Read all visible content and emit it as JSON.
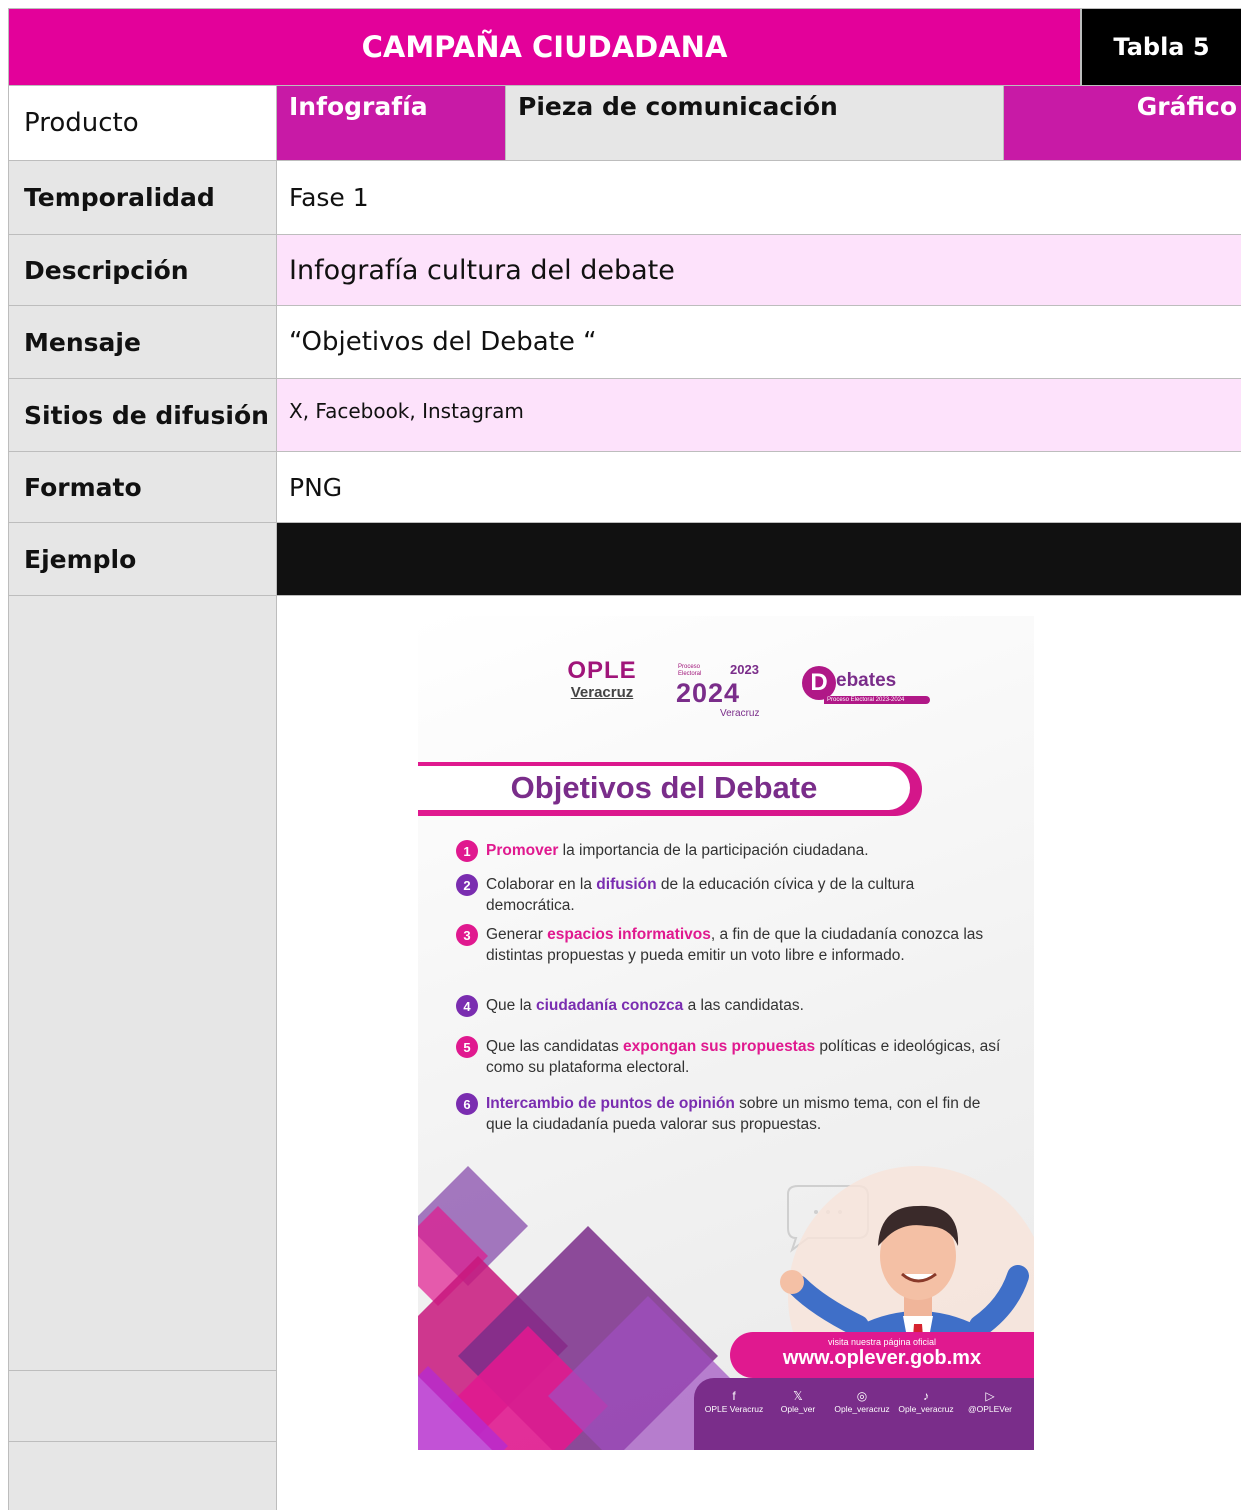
{
  "header": {
    "title": "CAMPAÑA CIUDADANA",
    "table_label": "Tabla 5"
  },
  "rows": {
    "producto": {
      "label": "Producto",
      "opt1": "Infografía",
      "opt2": "Pieza de comunicación",
      "opt3": "Gráfico"
    },
    "temporalidad": {
      "label": "Temporalidad",
      "value": "Fase 1"
    },
    "descripcion": {
      "label": "Descripción",
      "value": "Infografía cultura del debate"
    },
    "mensaje": {
      "label": "Mensaje",
      "value": "“Objetivos del Debate “"
    },
    "sitios": {
      "label": "Sitios de difusión",
      "value": "X, Facebook, Instagram"
    },
    "formato": {
      "label": "Formato",
      "value": "PNG"
    },
    "ejemplo": {
      "label": "Ejemplo"
    }
  },
  "infographic": {
    "logos": {
      "ople_top": "OPLE",
      "ople_bottom": "Veracruz",
      "proceso": "Proceso Electoral",
      "year_top": "2023",
      "year_main": "2024",
      "veracruz": "Veracruz",
      "debates_d": "D",
      "debates": "ebates",
      "debates_sub": "Proceso Electoral 2023-2024"
    },
    "title": "Objetivos del Debate",
    "objectives": [
      {
        "n": "1",
        "pre": "",
        "hl": "Promover",
        "post": " la importancia de la participación ciudadana."
      },
      {
        "n": "2",
        "pre": "Colaborar en la ",
        "hl": "difusión",
        "post": " de la educación cívica y de la cultura democrática."
      },
      {
        "n": "3",
        "pre": "Generar ",
        "hl": "espacios informativos",
        "post": ", a fin de que la ciudadanía conozca las distintas propuestas y pueda emitir un voto libre e informado."
      },
      {
        "n": "4",
        "pre": "Que la ",
        "hl": "ciudadanía conozca",
        "post": " a las candidatas."
      },
      {
        "n": "5",
        "pre": "Que las candidatas ",
        "hl": "expongan sus propuestas",
        "post": " políticas e ideológicas, así como su plataforma electoral."
      },
      {
        "n": "6",
        "pre": "",
        "hl": "Intercambio de puntos de opinión",
        "post": " sobre un mismo tema, con el fin de que la ciudadanía pueda valorar sus propuestas."
      }
    ],
    "footer": {
      "visit": "visita nuestra página oficial",
      "url": "www.oplever.gob.mx",
      "social": [
        {
          "icon": "f",
          "handle": "OPLE Veracruz",
          "name": "facebook-icon"
        },
        {
          "icon": "𝕏",
          "handle": "Ople_ver",
          "name": "x-icon"
        },
        {
          "icon": "◎",
          "handle": "Ople_veracruz",
          "name": "instagram-icon"
        },
        {
          "icon": "♪",
          "handle": "Ople_veracruz",
          "name": "tiktok-icon"
        },
        {
          "icon": "▷",
          "handle": "@OPLEVer",
          "name": "youtube-icon"
        }
      ]
    },
    "colors": {
      "magenta": "#e0198f",
      "purple": "#7a2db0"
    }
  }
}
